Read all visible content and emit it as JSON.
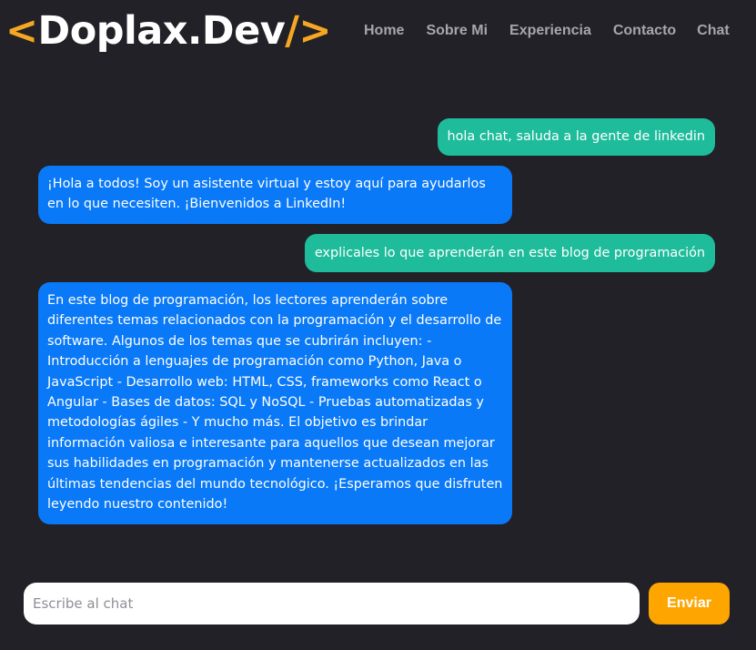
{
  "header": {
    "logo": {
      "open_bracket": "<",
      "name": "Doplax.Dev",
      "close_bracket": "/>"
    },
    "nav": [
      {
        "label": "Home"
      },
      {
        "label": "Sobre Mi"
      },
      {
        "label": "Experiencia"
      },
      {
        "label": "Contacto"
      },
      {
        "label": "Chat"
      }
    ]
  },
  "chat": {
    "messages": [
      {
        "role": "user",
        "text": "hola chat, saluda a la gente de linkedin"
      },
      {
        "role": "assistant",
        "text": "¡Hola a todos! Soy un asistente virtual y estoy aquí para ayudarlos en lo que necesiten. ¡Bienvenidos a LinkedIn!"
      },
      {
        "role": "user",
        "text": "explicales lo que aprenderán en este blog de programación"
      },
      {
        "role": "assistant",
        "text": "En este blog de programación, los lectores aprenderán sobre diferentes temas relacionados con la programación y el desarrollo de software. Algunos de los temas que se cubrirán incluyen: - Introducción a lenguajes de programación como Python, Java o JavaScript - Desarrollo web: HTML, CSS, frameworks como React o Angular - Bases de datos: SQL y NoSQL - Pruebas automatizadas y metodologías ágiles - Y mucho más. El objetivo es brindar información valiosa e interesante para aquellos que desean mejorar sus habilidades en programación y mantenerse actualizados en las últimas tendencias del mundo tecnológico. ¡Esperamos que disfruten leyendo nuestro contenido!"
      }
    ]
  },
  "composer": {
    "placeholder": "Escribe al chat",
    "value": "",
    "send_label": "Enviar"
  },
  "colors": {
    "background": "#222128",
    "accent": "#ffa500",
    "user_bubble": "#1fbc9c",
    "assistant_bubble": "#0a79f7",
    "nav_text": "#a6a6ad"
  }
}
